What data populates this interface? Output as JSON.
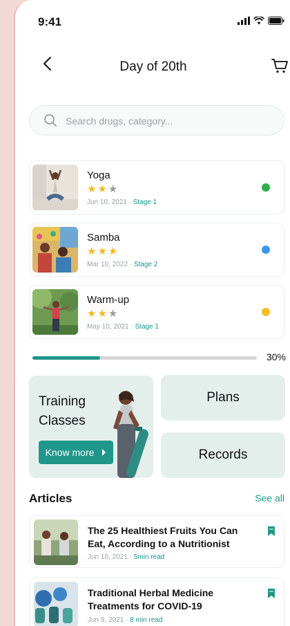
{
  "status": {
    "time": "9:41"
  },
  "header": {
    "title": "Day of 20th"
  },
  "search": {
    "placeholder": "Search drugs, category..."
  },
  "activities": [
    {
      "title": "Yoga",
      "rating": 2,
      "max_rating": 3,
      "date": "Jun 10, 2021",
      "stage": "Stage 1",
      "dot_color": "#2fae4a"
    },
    {
      "title": "Samba",
      "rating": 3,
      "max_rating": 3,
      "date": "Mar 10, 2022",
      "stage": "Stage 2",
      "dot_color": "#3b97ee"
    },
    {
      "title": "Warm-up",
      "rating": 2,
      "max_rating": 3,
      "date": "May 10, 2021",
      "stage": "Stage 1",
      "dot_color": "#f6be1e"
    }
  ],
  "progress": {
    "value": 0.3,
    "label": "30%"
  },
  "training": {
    "title_line1": "Training",
    "title_line2": "Classes",
    "button": "Know more"
  },
  "tiles": {
    "plans": "Plans",
    "records": "Records"
  },
  "articles_section": {
    "title": "Articles",
    "see_all": "See all"
  },
  "articles": [
    {
      "title": "The 25 Healthiest Fruits You Can Eat, According to a Nutritionist",
      "date": "Jun 10, 2021",
      "read": "5min read"
    },
    {
      "title": "Traditional Herbal Medicine Treatments for COVID-19",
      "date": "Jun 9, 2021",
      "read": "8 min read"
    }
  ],
  "colors": {
    "accent": "#1f978b",
    "tile_bg": "#e4efec",
    "star": "#f5b820"
  }
}
